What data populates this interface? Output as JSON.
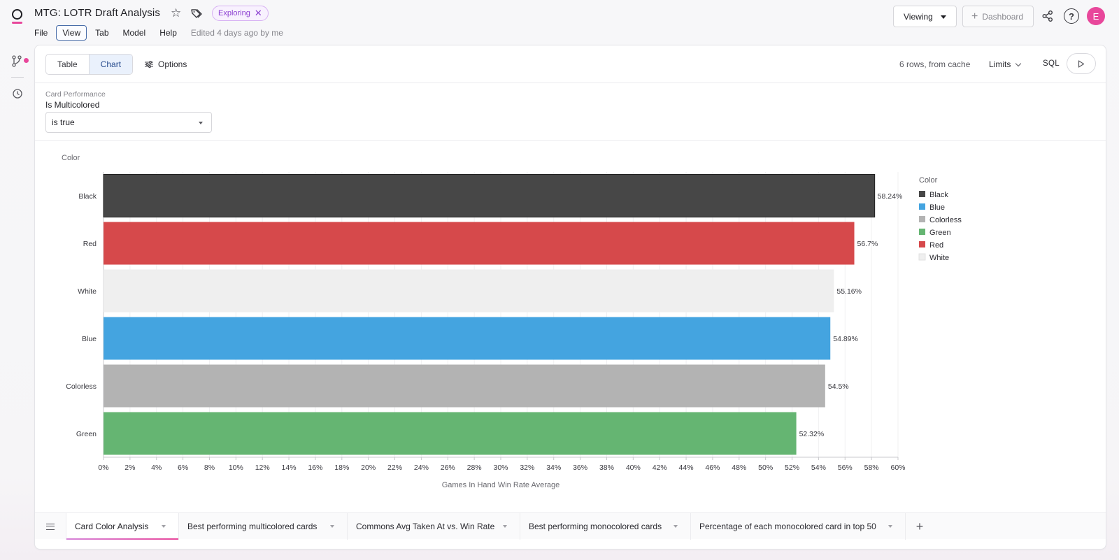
{
  "app": {
    "title": "MTG: LOTR Draft Analysis",
    "badge": "Exploring",
    "menu": [
      "File",
      "View",
      "Tab",
      "Model",
      "Help"
    ],
    "edited": "Edited 4 days ago by me",
    "viewing_label": "Viewing",
    "dashboard_label": "Dashboard",
    "avatar_initial": "E",
    "colors": {
      "accent_pink": "#e8479b",
      "badge_purple": "#8b3fd1"
    }
  },
  "toolbar": {
    "table_label": "Table",
    "chart_label": "Chart",
    "options_label": "Options",
    "rows_info": "6 rows, from cache",
    "limits_label": "Limits",
    "sql_label": "SQL"
  },
  "filter": {
    "source": "Card Performance",
    "field": "Is Multicolored",
    "value": "is true"
  },
  "chart_data": {
    "type": "bar",
    "orientation": "horizontal",
    "categories": [
      "Black",
      "Red",
      "White",
      "Blue",
      "Colorless",
      "Green"
    ],
    "values": [
      58.24,
      56.7,
      55.16,
      54.89,
      54.5,
      52.32
    ],
    "value_labels": [
      "58.24%",
      "56.7%",
      "55.16%",
      "54.89%",
      "54.5%",
      "52.32%"
    ],
    "bar_colors": [
      "#474747",
      "#d6494b",
      "#efefef",
      "#44a4e0",
      "#b3b3b3",
      "#65b572"
    ],
    "ylabel": "Color",
    "xlabel": "Games In Hand Win Rate Average",
    "xlim": [
      0,
      60
    ],
    "x_ticks": [
      "0%",
      "2%",
      "4%",
      "6%",
      "8%",
      "10%",
      "12%",
      "14%",
      "16%",
      "18%",
      "20%",
      "22%",
      "24%",
      "26%",
      "28%",
      "30%",
      "32%",
      "34%",
      "36%",
      "38%",
      "40%",
      "42%",
      "44%",
      "46%",
      "48%",
      "50%",
      "52%",
      "54%",
      "56%",
      "58%",
      "60%"
    ],
    "grid": true,
    "legend": {
      "title": "Color",
      "placement": "right",
      "items": [
        {
          "name": "Black",
          "color": "#474747"
        },
        {
          "name": "Blue",
          "color": "#44a4e0"
        },
        {
          "name": "Colorless",
          "color": "#b3b3b3"
        },
        {
          "name": "Green",
          "color": "#65b572"
        },
        {
          "name": "Red",
          "color": "#d6494b"
        },
        {
          "name": "White",
          "color": "#efefef"
        }
      ]
    }
  },
  "tabs": [
    {
      "label": "Card Color Analysis",
      "active": true
    },
    {
      "label": "Best performing multicolored cards",
      "active": false
    },
    {
      "label": "Commons Avg Taken At vs. Win Rate",
      "active": false
    },
    {
      "label": "Best performing monocolored cards",
      "active": false
    },
    {
      "label": "Percentage of each monocolored card in top 50",
      "active": false
    }
  ]
}
